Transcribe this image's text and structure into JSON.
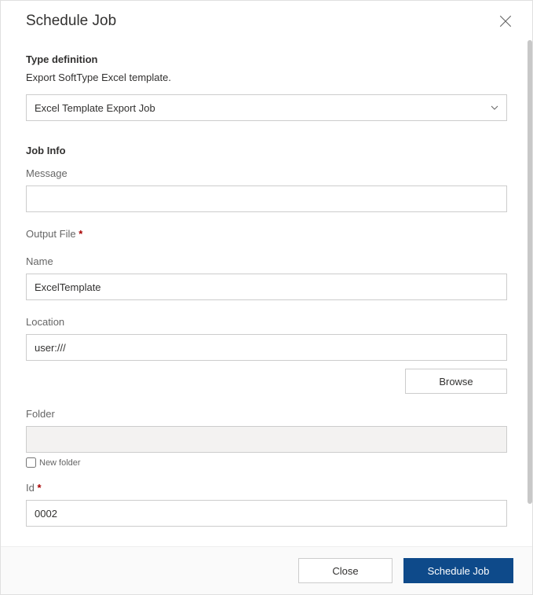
{
  "header": {
    "title": "Schedule Job"
  },
  "typeDefinition": {
    "heading": "Type definition",
    "description": "Export SoftType Excel template.",
    "selected": "Excel Template Export Job"
  },
  "jobInfo": {
    "heading": "Job Info",
    "messageLabel": "Message",
    "messageValue": ""
  },
  "outputFile": {
    "heading": "Output File",
    "nameLabel": "Name",
    "nameValue": "ExcelTemplate",
    "locationLabel": "Location",
    "locationValue": "user:///",
    "browseLabel": "Browse",
    "folderLabel": "Folder",
    "folderValue": "",
    "newFolderLabel": "New folder"
  },
  "idSection": {
    "label": "Id",
    "value": "0002"
  },
  "footer": {
    "closeLabel": "Close",
    "submitLabel": "Schedule Job"
  }
}
